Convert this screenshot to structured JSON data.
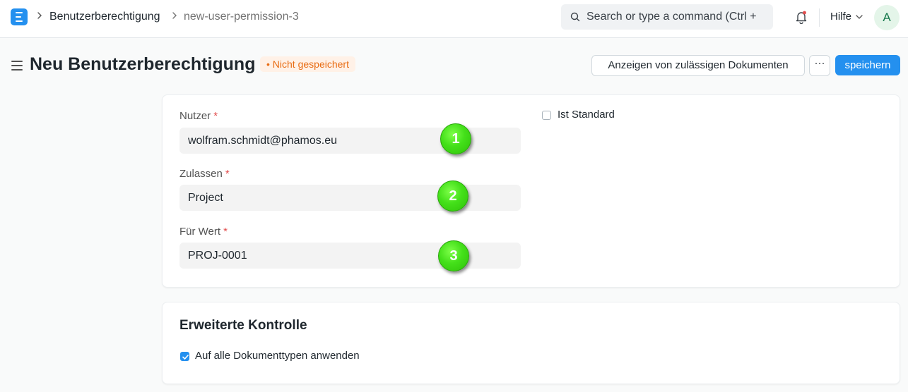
{
  "navbar": {
    "breadcrumbs": [
      "Benutzerberechtigung",
      "new-user-permission-3"
    ],
    "search_placeholder": "Search or type a command (Ctrl +",
    "help_label": "Hilfe",
    "avatar_initial": "A"
  },
  "page": {
    "title": "Neu Benutzerberechtigung",
    "status": "Nicht gespeichert",
    "actions": {
      "show_docs_label": "Anzeigen von zulässigen Dokumenten",
      "more_label": "···",
      "save_label": "speichern"
    }
  },
  "form": {
    "fields": [
      {
        "label": "Nutzer",
        "required_mark": "*",
        "value": "wolfram.schmidt@phamos.eu",
        "marker": "1"
      },
      {
        "label": "Zulassen",
        "required_mark": "*",
        "value": "Project",
        "marker": "2"
      },
      {
        "label": "Für Wert",
        "required_mark": "*",
        "value": "PROJ-0001",
        "marker": "3"
      }
    ],
    "is_default": {
      "label": "Ist Standard",
      "checked": false
    }
  },
  "advanced": {
    "title": "Erweiterte Kontrolle",
    "apply_all": {
      "label": "Auf alle Dokumenttypen anwenden",
      "checked": true
    }
  },
  "colors": {
    "primary": "#2490ef",
    "status_orange": "#e86c13",
    "marker_green": "#44e01a"
  },
  "icons": [
    "logo-icon",
    "chevron-right-icon",
    "search-icon",
    "bell-icon",
    "chevron-down-icon",
    "menu-icon",
    "check-icon"
  ]
}
